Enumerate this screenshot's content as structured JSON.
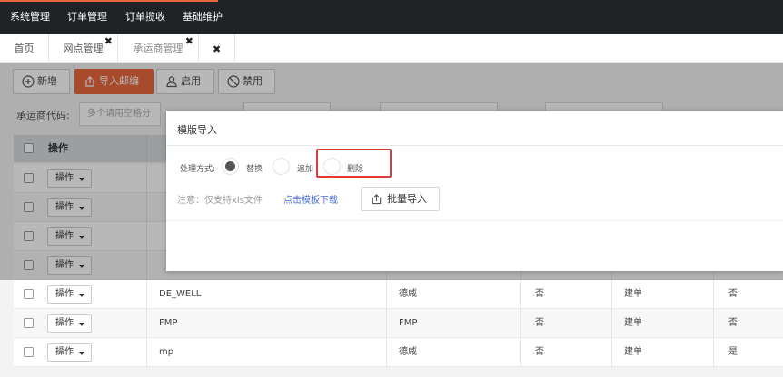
{
  "top_nav": {
    "items": [
      "系统管理",
      "订单管理",
      "订单揽收",
      "基础维护"
    ]
  },
  "tabs": [
    {
      "label": "首页"
    },
    {
      "label": "网点管理",
      "close": "✖"
    },
    {
      "label": "承运商管理",
      "close": "✖"
    },
    {
      "label": "",
      "close": "✖"
    }
  ],
  "toolbar": {
    "add_label": "新增",
    "import_label": "导入邮编",
    "enable_label": "启用",
    "disable_label": "禁用"
  },
  "filters": {
    "carrier_code_label": "承运商代码:",
    "carrier_code_placeholder": "多个请用空格分"
  },
  "table": {
    "headers": [
      "操作"
    ],
    "op_label": "操作",
    "rows": [
      {
        "code": "",
        "name": "",
        "c3": "",
        "c4": "",
        "c5": ""
      },
      {
        "code": "",
        "name": "",
        "c3": "",
        "c4": "",
        "c5": ""
      },
      {
        "code": "",
        "name": "",
        "c3": "",
        "c4": "",
        "c5": ""
      },
      {
        "code": "",
        "name": "",
        "c3": "",
        "c4": "",
        "c5": ""
      },
      {
        "code": "DE_WELL",
        "name": "德威",
        "c3": "否",
        "c4": "建单",
        "c5": "否"
      },
      {
        "code": "FMP",
        "name": "FMP",
        "c3": "否",
        "c4": "建单",
        "c5": "否"
      },
      {
        "code": "mp",
        "name": "德威",
        "c3": "否",
        "c4": "建单",
        "c5": "是"
      }
    ]
  },
  "modal": {
    "title": "模版导入",
    "mode_label": "处理方式:",
    "options": [
      {
        "label": "替换",
        "selected": true
      },
      {
        "label": "追加",
        "selected": false
      },
      {
        "label": "删除",
        "selected": false
      }
    ],
    "note": "注意：仅支持xls文件",
    "download_link": "点击模板下载",
    "upload_button": "批量导入"
  },
  "colors": {
    "accent": "#e8683e",
    "nav_bg": "#1f2326",
    "highlight_box": "#e23a3a",
    "link": "#4a6fd8"
  }
}
